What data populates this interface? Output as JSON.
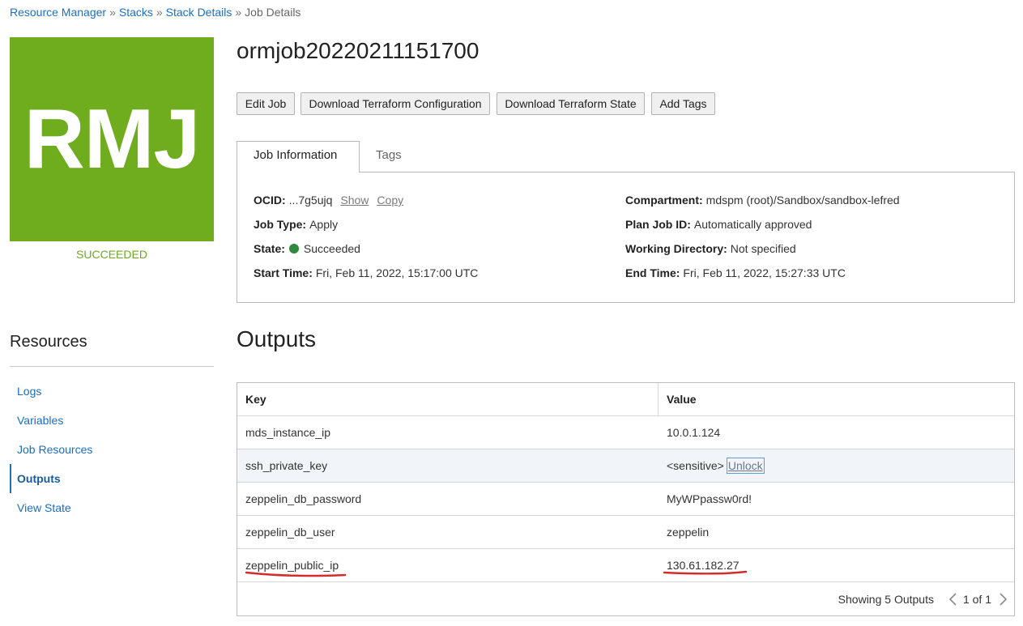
{
  "breadcrumb": {
    "separator": "»",
    "items": [
      {
        "label": "Resource Manager"
      },
      {
        "label": "Stacks"
      },
      {
        "label": "Stack Details"
      },
      {
        "label": "Job Details"
      }
    ]
  },
  "badge": {
    "initials": "RMJ",
    "status": "SUCCEEDED"
  },
  "page_title": "ormjob20220211151700",
  "actions": {
    "edit_job": "Edit Job",
    "download_config": "Download Terraform Configuration",
    "download_state": "Download Terraform State",
    "add_tags": "Add Tags"
  },
  "tabs": [
    {
      "label": "Job Information",
      "active": true
    },
    {
      "label": "Tags",
      "active": false
    }
  ],
  "job_info": {
    "ocid": {
      "label": "OCID:",
      "value": "...7g5ujq",
      "show": "Show",
      "copy": "Copy"
    },
    "job_type": {
      "label": "Job Type:",
      "value": "Apply"
    },
    "state": {
      "label": "State:",
      "value": "Succeeded"
    },
    "start_time": {
      "label": "Start Time:",
      "value": "Fri, Feb 11, 2022, 15:17:00 UTC"
    },
    "compartment": {
      "label": "Compartment:",
      "value": "mdspm (root)/Sandbox/sandbox-lefred"
    },
    "plan_job_id": {
      "label": "Plan Job ID:",
      "value": "Automatically approved"
    },
    "working_directory": {
      "label": "Working Directory:",
      "value": "Not specified"
    },
    "end_time": {
      "label": "End Time:",
      "value": "Fri, Feb 11, 2022, 15:27:33 UTC"
    }
  },
  "resources": {
    "heading": "Resources",
    "items": [
      {
        "label": "Logs",
        "active": false
      },
      {
        "label": "Variables",
        "active": false
      },
      {
        "label": "Job Resources",
        "active": false
      },
      {
        "label": "Outputs",
        "active": true
      },
      {
        "label": "View State",
        "active": false
      }
    ]
  },
  "outputs": {
    "heading": "Outputs",
    "columns": {
      "key": "Key",
      "value": "Value"
    },
    "rows": [
      {
        "key": "mds_instance_ip",
        "value": "10.0.1.124",
        "highlighted": false
      },
      {
        "key": "ssh_private_key",
        "value": "<sensitive>",
        "action": "Unlock",
        "highlighted": true
      },
      {
        "key": "zeppelin_db_password",
        "value": "MyWPpassw0rd!",
        "highlighted": false
      },
      {
        "key": "zeppelin_db_user",
        "value": "zeppelin",
        "highlighted": false
      },
      {
        "key": "zeppelin_public_ip",
        "value": "130.61.182.27",
        "highlighted": false
      }
    ],
    "footer": {
      "summary": "Showing 5 Outputs",
      "page": "1 of 1"
    }
  },
  "icons": {
    "state": "status-dot-icon",
    "prev_page": "chevron-left-icon",
    "next_page": "chevron-right-icon"
  },
  "colors": {
    "link": "#1b6ec2",
    "badge_bg": "#6fad1f",
    "success_text": "#6cab20",
    "status_dot": "#2e8a3e",
    "row_highlight": "#f1f5fa",
    "annotation": "#d42b2b"
  }
}
